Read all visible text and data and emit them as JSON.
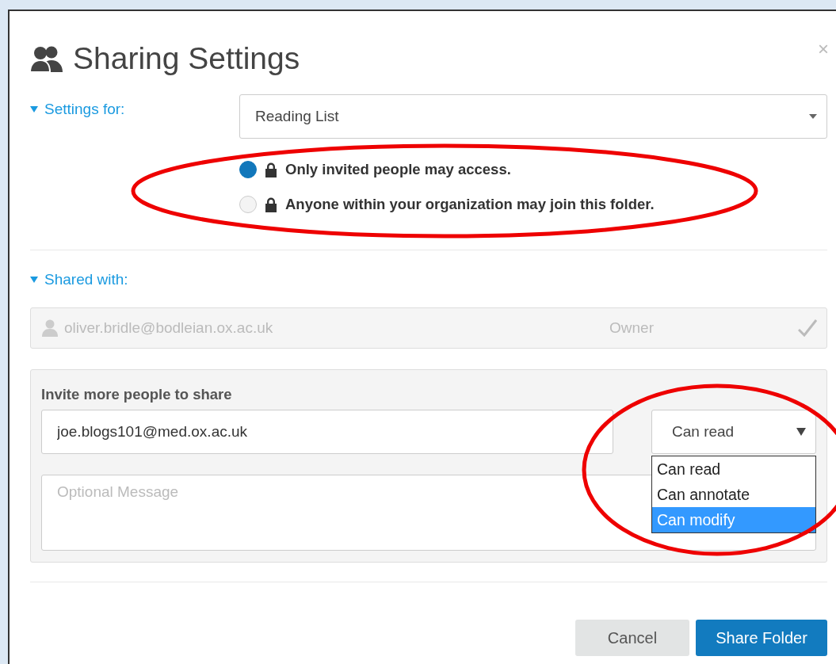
{
  "dialog": {
    "title": "Sharing Settings",
    "close": "×"
  },
  "settings_for": {
    "label": "Settings for:",
    "expanded": true,
    "folder": {
      "value": "Reading List"
    },
    "access": [
      {
        "label": "Only invited people may access.",
        "selected": true
      },
      {
        "label": "Anyone within your organization may join this folder.",
        "selected": false
      }
    ]
  },
  "shared_with": {
    "label": "Shared with:",
    "expanded": true,
    "members": [
      {
        "email": "oliver.bridle@bodleian.ox.ac.uk",
        "role": "Owner"
      }
    ]
  },
  "invite": {
    "label": "Invite more people to share",
    "email": {
      "value": "joe.blogs101@med.ox.ac.uk"
    },
    "permission": {
      "value": "Can read",
      "open": true,
      "options": [
        {
          "label": "Can read",
          "highlighted": false
        },
        {
          "label": "Can annotate",
          "highlighted": false
        },
        {
          "label": "Can modify",
          "highlighted": true
        }
      ]
    },
    "message": {
      "placeholder": "Optional Message"
    }
  },
  "buttons": [
    {
      "label": "Cancel",
      "kind": "secondary"
    },
    {
      "label": "Share Folder",
      "kind": "primary"
    }
  ]
}
